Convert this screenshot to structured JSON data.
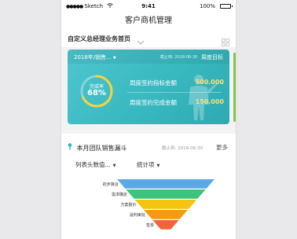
{
  "status_bar": {
    "carrier": "Sketch",
    "time": "9:41",
    "battery": "100%"
  },
  "nav": {
    "title": "客户商机管理"
  },
  "homepage": {
    "title": "自定义总经理业务首页"
  },
  "target_card": {
    "selector": "2018年/销售...",
    "deadline": "截止到: 2018-06-30",
    "week_goal": "周度目标",
    "ring_label": "完成率",
    "ring_value": "68%",
    "completion": 0.68,
    "metrics": [
      {
        "label": "周度签约指标金额",
        "value": "500.000"
      },
      {
        "label": "周度签约完成金额",
        "value": "150.000"
      }
    ]
  },
  "team_funnel": {
    "title": "本月团队销售漏斗",
    "deadline": "截止到: 2018-06-30",
    "more": "更多",
    "filter1": "列表头数值...",
    "filter2": "统计项",
    "stages": [
      {
        "label": "初步接洽",
        "color": "#5aa9e6"
      },
      {
        "label": "需求确定",
        "color": "#3cc47c"
      },
      {
        "label": "方案报价",
        "color": "#f4c40f"
      },
      {
        "label": "谈判审批",
        "color": "#f39c12"
      },
      {
        "label": "签单",
        "color": "#f0643a"
      }
    ]
  },
  "colors": {
    "accent": "#38b8c0",
    "highlight": "#f9e27a",
    "ring_progress": "#f6d33c"
  }
}
